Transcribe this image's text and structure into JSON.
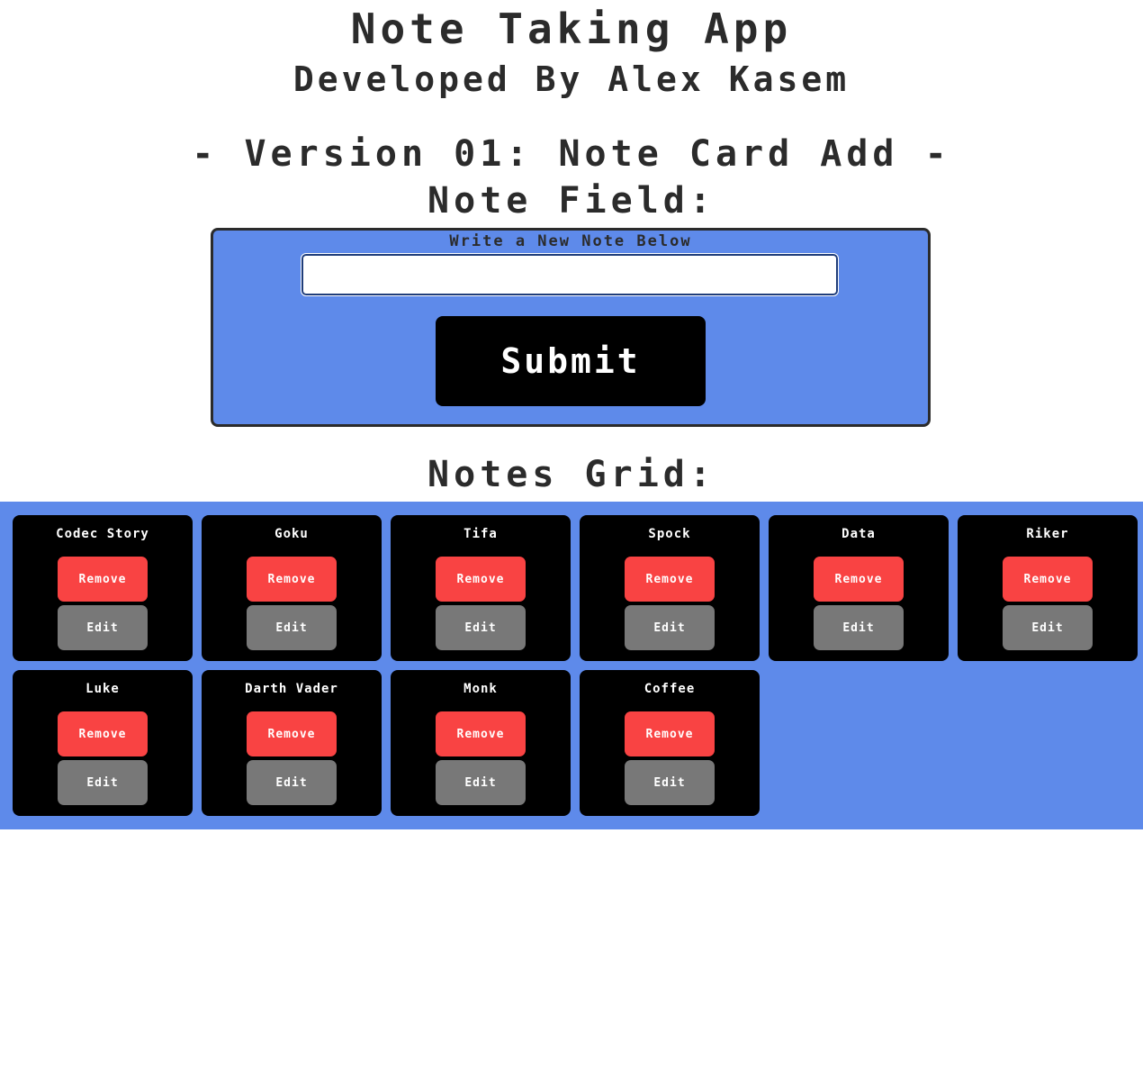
{
  "header": {
    "title": "Note Taking App",
    "subtitle": "Developed By Alex Kasem",
    "version": "- Version 01: Note Card Add -"
  },
  "note_field": {
    "heading": "Note Field:",
    "label": "Write a New Note Below",
    "input_value": "",
    "submit_label": "Submit"
  },
  "notes_grid": {
    "heading": "Notes Grid:",
    "remove_label": "Remove",
    "edit_label": "Edit",
    "notes": [
      {
        "title": "Codec Story"
      },
      {
        "title": "Goku"
      },
      {
        "title": "Tifa"
      },
      {
        "title": "Spock"
      },
      {
        "title": "Data"
      },
      {
        "title": "Riker"
      },
      {
        "title": "Luke"
      },
      {
        "title": "Darth Vader"
      },
      {
        "title": "Monk"
      },
      {
        "title": "Coffee"
      }
    ]
  },
  "colors": {
    "panel_blue": "#5e8aea",
    "remove_red": "#f94343",
    "edit_gray": "#787878",
    "card_black": "#000000"
  }
}
